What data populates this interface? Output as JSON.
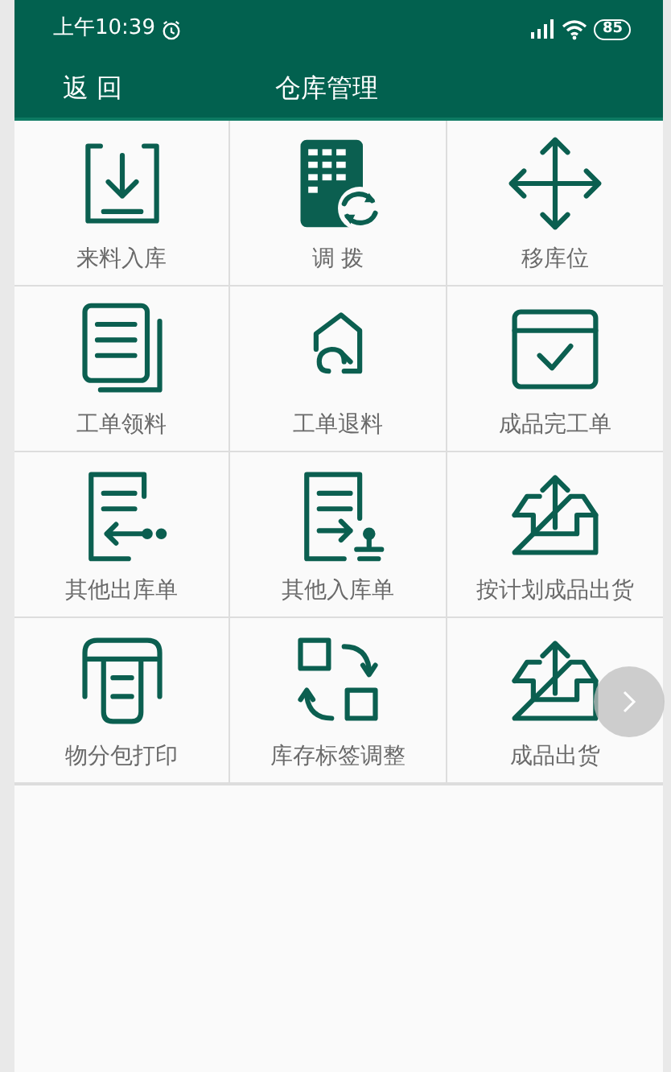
{
  "status_bar": {
    "time": "上午10:39",
    "battery": "85"
  },
  "toolbar": {
    "back": "返 回",
    "title": "仓库管理"
  },
  "menu": [
    {
      "label": "来料入库"
    },
    {
      "label": "调 拨"
    },
    {
      "label": "移库位"
    },
    {
      "label": "工单领料"
    },
    {
      "label": "工单退料"
    },
    {
      "label": "成品完工单"
    },
    {
      "label": "其他出库单"
    },
    {
      "label": "其他入库单"
    },
    {
      "label": "按计划成品出货"
    },
    {
      "label": "物分包打印"
    },
    {
      "label": "库存标签调整"
    },
    {
      "label": "成品出货"
    }
  ]
}
